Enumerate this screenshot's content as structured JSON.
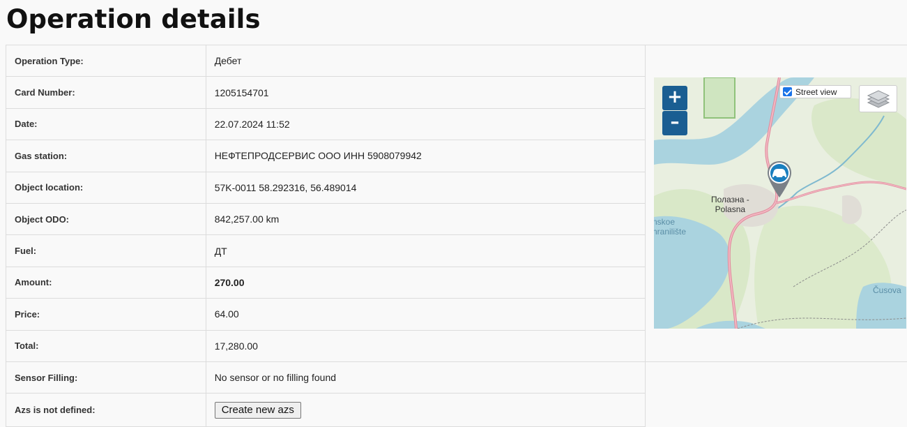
{
  "page": {
    "title": "Operation details"
  },
  "rows": [
    {
      "label": "Operation Type:",
      "value": "Дебет"
    },
    {
      "label": "Card Number:",
      "value": "1205154701"
    },
    {
      "label": "Date:",
      "value": "22.07.2024 11:52"
    },
    {
      "label": "Gas station:",
      "value": "НЕФТЕПРОДСЕРВИС ООО ИНН 5908079942"
    },
    {
      "label": "Object location:",
      "value": "57K-0011 58.292316, 56.489014"
    },
    {
      "label": "Object ODO:",
      "value": "842,257.00 km"
    },
    {
      "label": "Fuel:",
      "value": "ДТ"
    },
    {
      "label": "Amount:",
      "value": "270.00"
    },
    {
      "label": "Price:",
      "value": "64.00"
    },
    {
      "label": "Total:",
      "value": "17,280.00"
    },
    {
      "label": "Sensor Filling:",
      "value": "No sensor or no filling found"
    },
    {
      "label": "Azs is not defined:",
      "button": "Create new azs"
    }
  ],
  "map": {
    "zoom_in": "+",
    "zoom_out": "–",
    "street_view_label": "Street view",
    "street_view_checked": true,
    "labels": {
      "town_line1": "Полазна -",
      "town_line2": "Polasna",
      "left_line1": "nskoe",
      "left_line2": "hranilište",
      "right": "Čusova"
    },
    "colors": {
      "water": "#aad3df",
      "land": "#e9efe0",
      "forest": "#d6e6c5",
      "road": "#e891a1",
      "accent": "#1a5e92"
    },
    "marker_icon": "car-marker-icon"
  }
}
